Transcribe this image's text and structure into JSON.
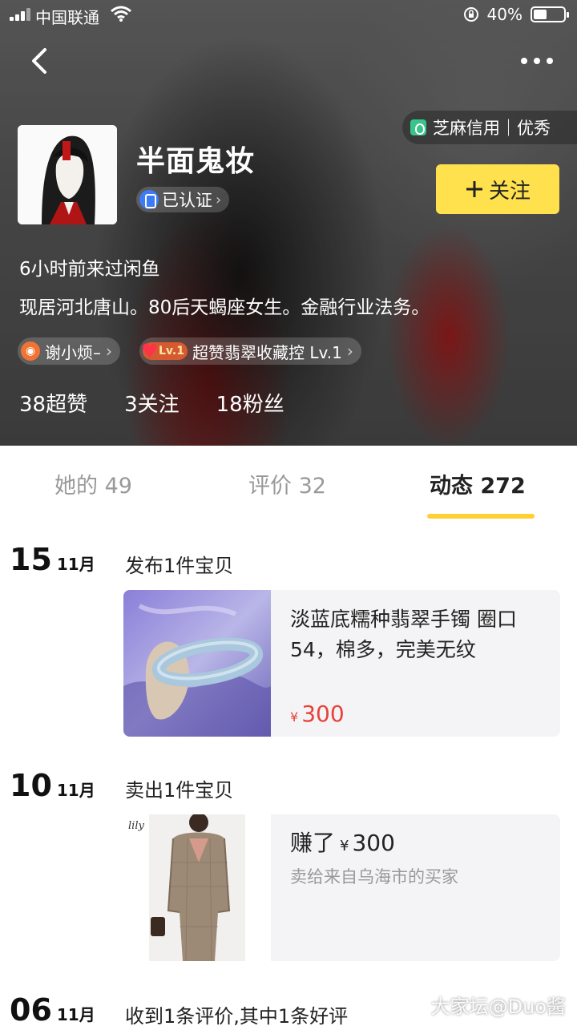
{
  "status_bar": {
    "carrier": "中国联通",
    "battery": "40%"
  },
  "profile": {
    "credit_label": "芝麻信用｜优秀",
    "nickname": "半面鬼妆",
    "verified_label": "已认证",
    "follow_label": "关注",
    "last_visit": "6小时前来过闲鱼",
    "bio": "现居河北唐山。80后天蝎座女生。金融行业法务。",
    "weibo_tag": "谢小烦–",
    "level_badge": "Lv.1",
    "fan_tag": "超赞翡翠收藏控 Lv.1",
    "stats": {
      "likes": "38超赞",
      "following": "3关注",
      "fans": "18粉丝"
    }
  },
  "tabs": [
    {
      "label": "她的 49",
      "active": false
    },
    {
      "label": "评价 32",
      "active": false
    },
    {
      "label": "动态 272",
      "active": true
    }
  ],
  "timeline": [
    {
      "day": "15",
      "month": "11月",
      "title": "发布1件宝贝",
      "item_title": "淡蓝底糯种翡翠手镯 圈口54，棉多，完美无纹",
      "currency": "¥",
      "price": "300"
    },
    {
      "day": "10",
      "month": "11月",
      "title": "卖出1件宝贝",
      "earned_prefix": "赚了",
      "currency": "¥",
      "earned_amount": "300",
      "buyer": "卖给来自乌海市的买家",
      "image_logo": "lily"
    },
    {
      "day": "06",
      "month": "11月",
      "title": "收到1条评价,其中1条好评"
    }
  ],
  "watermark": "大家坛@Duo酱"
}
